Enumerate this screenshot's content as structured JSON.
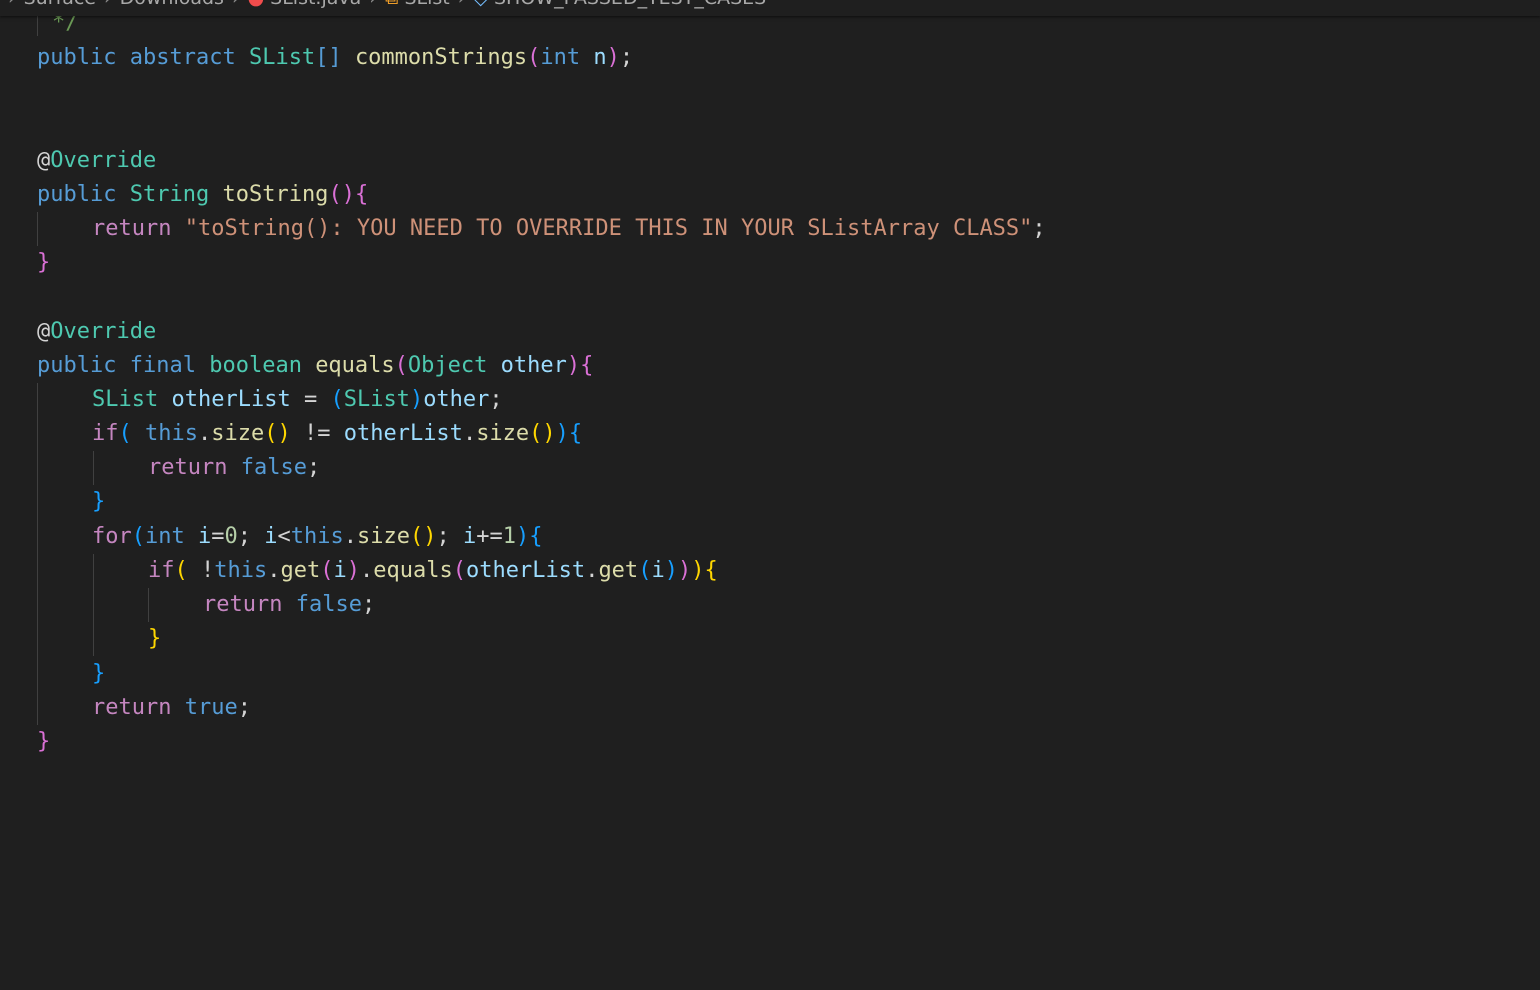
{
  "breadcrumb": {
    "items": [
      {
        "label": "Surface"
      },
      {
        "label": "Downloads"
      },
      {
        "label": "SList.java"
      },
      {
        "label": "SList"
      },
      {
        "label": "SHOW_PASSED_TEST_CASES"
      }
    ],
    "separator": "›"
  },
  "code": {
    "comment_close": "*/",
    "line1": {
      "public": "public",
      "abstract": "abstract",
      "type": "SList",
      "brackets": "[]",
      "name": "commonStrings",
      "open": "(",
      "int": "int",
      "param": "n",
      "close": ")",
      "semi": ";"
    },
    "override1": {
      "at": "@",
      "name": "Override"
    },
    "tostring": {
      "public": "public",
      "type": "String",
      "name": "toString",
      "open": "(",
      "close": ")",
      "brace": "{"
    },
    "return_str": {
      "return": "return",
      "literal": "\"toString(): YOU NEED TO OVERRIDE THIS IN YOUR SListArray CLASS\"",
      "semi": ";"
    },
    "close_tostring": "}",
    "override2": {
      "at": "@",
      "name": "Override"
    },
    "equals_sig": {
      "public": "public",
      "final": "final",
      "boolean": "boolean",
      "name": "equals",
      "open": "(",
      "type": "Object",
      "param": "other",
      "close": ")",
      "brace": "{"
    },
    "cast_line": {
      "type": "SList",
      "var": "otherList",
      "eq": "=",
      "open": "(",
      "cast": "SList",
      "close": ")",
      "src": "other",
      "semi": ";"
    },
    "if1": {
      "if": "if",
      "open": "(",
      "this": "this",
      "dot": ".",
      "size": "size",
      "call": "()",
      "ne": "!=",
      "other": "otherList",
      "dot2": ".",
      "size2": "size",
      "call2": "()",
      "close": ")",
      "brace": "{"
    },
    "ret_false1": {
      "return": "return",
      "false": "false",
      "semi": ";"
    },
    "close_if1": "}",
    "for_line": {
      "for": "for",
      "open": "(",
      "int": "int",
      "i": "i",
      "init": "=",
      "zero": "0",
      "semi1": ";",
      "i2": "i",
      "lt": "<",
      "this": "this",
      "dot": ".",
      "size": "size",
      "call": "()",
      "semi2": ";",
      "i3": "i",
      "inc": "+=",
      "one": "1",
      "close": ")",
      "brace": "{"
    },
    "if2": {
      "if": "if",
      "open": "(",
      "not": "!",
      "this": "this",
      "dot": ".",
      "get": "get",
      "p_open": "(",
      "i": "i",
      "p_close": ")",
      "dot2": ".",
      "equals": "equals",
      "e_open": "(",
      "other": "otherList",
      "dot3": ".",
      "get2": "get",
      "g_open": "(",
      "i2": "i",
      "g_close": ")",
      "e_close": ")",
      "close": ")",
      "brace": "{"
    },
    "ret_false2": {
      "return": "return",
      "false": "false",
      "semi": ";"
    },
    "close_if2": "}",
    "close_for": "}",
    "ret_true": {
      "return": "return",
      "true": "true",
      "semi": ";"
    },
    "close_equals": "}"
  }
}
